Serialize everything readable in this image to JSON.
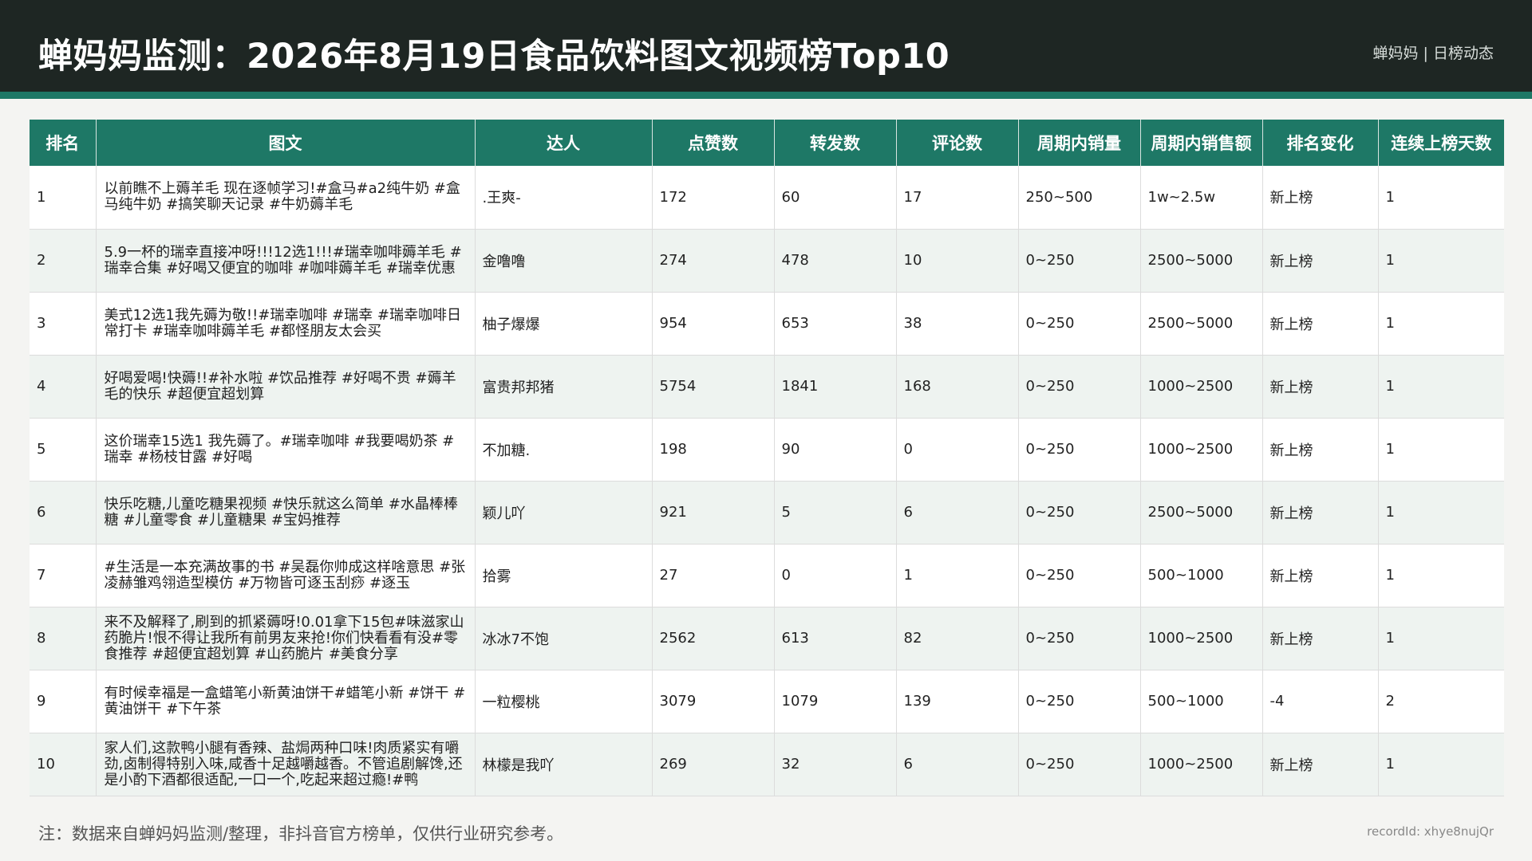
{
  "header": {
    "title": "蝉妈妈监测：2026年8月19日食品饮料图文视频榜Top10",
    "brand": "蝉妈妈 | 日榜动态",
    "accent_color": "#1e7866",
    "background_color": "#1e2623"
  },
  "table": {
    "columns": [
      "排名",
      "图文",
      "达人",
      "点赞数",
      "转发数",
      "评论数",
      "周期内销量",
      "周期内销售额",
      "排名变化",
      "连续上榜天数"
    ],
    "rows": [
      [
        "1",
        "以前瞧不上薅羊毛 现在逐帧学习!#盒马#a2纯牛奶 #盒马纯牛奶 #搞笑聊天记录 #牛奶薅羊毛",
        ".王爽-",
        "172",
        "60",
        "17",
        "250~500",
        "1w~2.5w",
        "新上榜",
        "1"
      ],
      [
        "2",
        "5.9一杯的瑞幸直接冲呀!!!12选1!!!#瑞幸咖啡薅羊毛 #瑞幸合集 #好喝又便宜的咖啡 #咖啡薅羊毛 #瑞幸优惠",
        "金噜噜",
        "274",
        "478",
        "10",
        "0~250",
        "2500~5000",
        "新上榜",
        "1"
      ],
      [
        "3",
        "美式12选1我先薅为敬!!#瑞幸咖啡 #瑞幸 #瑞幸咖啡日常打卡 #瑞幸咖啡薅羊毛 #都怪朋友太会买",
        "柚子爆爆",
        "954",
        "653",
        "38",
        "0~250",
        "2500~5000",
        "新上榜",
        "1"
      ],
      [
        "4",
        "好喝爱喝!快薅!!#补水啦 #饮品推荐 #好喝不贵 #薅羊毛的快乐 #超便宜超划算",
        "富贵邦邦猪",
        "5754",
        "1841",
        "168",
        "0~250",
        "1000~2500",
        "新上榜",
        "1"
      ],
      [
        "5",
        "这价瑞幸15选1 我先薅了。#瑞幸咖啡 #我要喝奶茶 #瑞幸 #杨枝甘露 #好喝",
        "不加糖.",
        "198",
        "90",
        "0",
        "0~250",
        "1000~2500",
        "新上榜",
        "1"
      ],
      [
        "6",
        "快乐吃糖,儿童吃糖果视频 #快乐就这么简单 #水晶棒棒糖 #儿童零食 #儿童糖果 #宝妈推荐",
        "颖儿吖",
        "921",
        "5",
        "6",
        "0~250",
        "2500~5000",
        "新上榜",
        "1"
      ],
      [
        "7",
        "#生活是一本充满故事的书 #吴磊你帅成这样啥意思 #张凌赫雏鸡翎造型模仿 #万物皆可逐玉刮痧 #逐玉",
        "拾雾",
        "27",
        "0",
        "1",
        "0~250",
        "500~1000",
        "新上榜",
        "1"
      ],
      [
        "8",
        "来不及解释了,刷到的抓紧薅呀!0.01拿下15包#味滋家山药脆片!恨不得让我所有前男友来抢!你们快看看有没#零食推荐 #超便宜超划算 #山药脆片 #美食分享",
        "冰冰7不饱",
        "2562",
        "613",
        "82",
        "0~250",
        "1000~2500",
        "新上榜",
        "1"
      ],
      [
        "9",
        "有时候幸福是一盒蜡笔小新黄油饼干#蜡笔小新 #饼干 #黄油饼干 #下午茶",
        "一粒樱桃",
        "3079",
        "1079",
        "139",
        "0~250",
        "500~1000",
        "-4",
        "2"
      ],
      [
        "10",
        "家人们,这款鸭小腿有香辣、盐焗两种口味!肉质紧实有嚼劲,卤制得特别入味,咸香十足越嚼越香。不管追剧解馋,还是小酌下酒都很适配,一口一个,吃起来超过瘾!#鸭",
        "林檬是我吖",
        "269",
        "32",
        "6",
        "0~250",
        "1000~2500",
        "新上榜",
        "1"
      ]
    ]
  },
  "footer": {
    "note": "注：数据来自蝉妈妈监测/整理，非抖音官方榜单，仅供行业研究参考。",
    "record_id": "recordId: xhye8nujQr"
  }
}
